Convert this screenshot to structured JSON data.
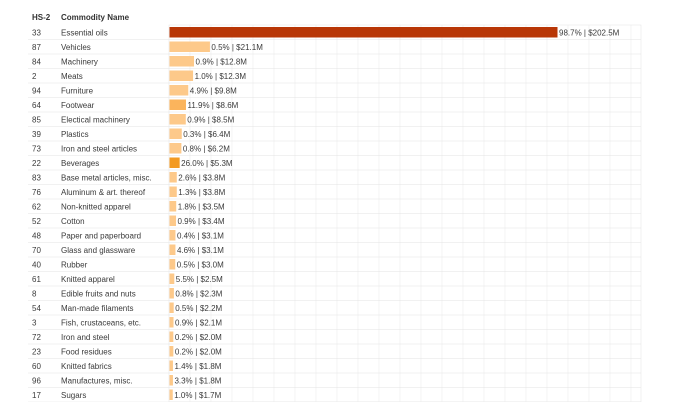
{
  "chart_data": {
    "type": "bar",
    "orientation": "horizontal",
    "x_max": 202.5,
    "columns": {
      "code": "HS-2",
      "name": "Commodity Name"
    },
    "colors": {
      "top": "#b83606",
      "strong": "#f39a22",
      "mid": "#fbb45c",
      "light": "#fdc98a"
    },
    "rows": [
      {
        "code": "33",
        "name": "Essential oils",
        "pct": 98.7,
        "value": 202.5,
        "label": "98.7% | $202.5M"
      },
      {
        "code": "87",
        "name": "Vehicles",
        "pct": 0.5,
        "value": 21.1,
        "label": "0.5% | $21.1M"
      },
      {
        "code": "84",
        "name": "Machinery",
        "pct": 0.9,
        "value": 12.8,
        "label": "0.9% | $12.8M"
      },
      {
        "code": "2",
        "name": "Meats",
        "pct": 1.0,
        "value": 12.3,
        "label": "1.0% | $12.3M"
      },
      {
        "code": "94",
        "name": "Furniture",
        "pct": 4.9,
        "value": 9.8,
        "label": "4.9% | $9.8M"
      },
      {
        "code": "64",
        "name": "Footwear",
        "pct": 11.9,
        "value": 8.6,
        "label": "11.9% | $8.6M"
      },
      {
        "code": "85",
        "name": "Electical machinery",
        "pct": 0.9,
        "value": 8.5,
        "label": "0.9% | $8.5M"
      },
      {
        "code": "39",
        "name": "Plastics",
        "pct": 0.3,
        "value": 6.4,
        "label": "0.3% | $6.4M"
      },
      {
        "code": "73",
        "name": "Iron and steel articles",
        "pct": 0.8,
        "value": 6.2,
        "label": "0.8% | $6.2M"
      },
      {
        "code": "22",
        "name": "Beverages",
        "pct": 26.0,
        "value": 5.3,
        "label": "26.0% | $5.3M"
      },
      {
        "code": "83",
        "name": "Base metal articles, misc.",
        "pct": 2.6,
        "value": 3.8,
        "label": "2.6% | $3.8M"
      },
      {
        "code": "76",
        "name": "Aluminum & art. thereof",
        "pct": 1.3,
        "value": 3.8,
        "label": "1.3% | $3.8M"
      },
      {
        "code": "62",
        "name": "Non-knitted apparel",
        "pct": 1.8,
        "value": 3.5,
        "label": "1.8% | $3.5M"
      },
      {
        "code": "52",
        "name": "Cotton",
        "pct": 0.9,
        "value": 3.4,
        "label": "0.9% | $3.4M"
      },
      {
        "code": "48",
        "name": "Paper and paperboard",
        "pct": 0.4,
        "value": 3.1,
        "label": "0.4% | $3.1M"
      },
      {
        "code": "70",
        "name": "Glass and glassware",
        "pct": 4.6,
        "value": 3.1,
        "label": "4.6% | $3.1M"
      },
      {
        "code": "40",
        "name": "Rubber",
        "pct": 0.5,
        "value": 3.0,
        "label": "0.5% | $3.0M"
      },
      {
        "code": "61",
        "name": "Knitted apparel",
        "pct": 5.5,
        "value": 2.5,
        "label": "5.5% | $2.5M"
      },
      {
        "code": "8",
        "name": "Edible fruits and nuts",
        "pct": 0.8,
        "value": 2.3,
        "label": "0.8% | $2.3M"
      },
      {
        "code": "54",
        "name": "Man-made filaments",
        "pct": 0.5,
        "value": 2.2,
        "label": "0.5% | $2.2M"
      },
      {
        "code": "3",
        "name": "Fish, crustaceans, etc.",
        "pct": 0.9,
        "value": 2.1,
        "label": "0.9% | $2.1M"
      },
      {
        "code": "72",
        "name": "Iron and steel",
        "pct": 0.2,
        "value": 2.0,
        "label": "0.2% | $2.0M"
      },
      {
        "code": "23",
        "name": "Food residues",
        "pct": 0.2,
        "value": 2.0,
        "label": "0.2% | $2.0M"
      },
      {
        "code": "60",
        "name": "Knitted fabrics",
        "pct": 1.4,
        "value": 1.8,
        "label": "1.4% | $1.8M"
      },
      {
        "code": "96",
        "name": "Manufactures, misc.",
        "pct": 3.3,
        "value": 1.8,
        "label": "3.3% | $1.8M"
      },
      {
        "code": "17",
        "name": "Sugars",
        "pct": 1.0,
        "value": 1.7,
        "label": "1.0% | $1.7M"
      }
    ]
  }
}
